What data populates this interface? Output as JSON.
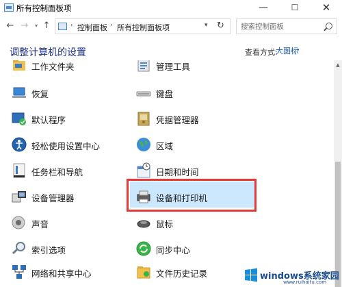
{
  "window": {
    "title": "所有控制面板项",
    "minimize_glyph": "—",
    "maximize_glyph": "☐",
    "close_glyph": "✕"
  },
  "navigation": {
    "back_glyph": "←",
    "forward_glyph": "→",
    "recent_glyph": "▾",
    "up_glyph": "↑",
    "breadcrumbs": [
      "控制面板",
      "所有控制面板项"
    ],
    "breadcrumb_separator": "›",
    "address_dropdown_glyph": "▾",
    "refresh_glyph": "↻"
  },
  "search": {
    "placeholder": "搜索控制面板",
    "value": ""
  },
  "header": {
    "title": "调整计算机的设置",
    "view_by_label": "查看方式:",
    "view_by_value": "大图标",
    "view_by_arrow": "▾"
  },
  "items": [
    {
      "label": "工作文件夹",
      "icon": "work-folders-icon"
    },
    {
      "label": "管理工具",
      "icon": "admin-tools-icon"
    },
    {
      "label": "恢复",
      "icon": "recovery-icon"
    },
    {
      "label": "键盘",
      "icon": "keyboard-icon"
    },
    {
      "label": "默认程序",
      "icon": "default-programs-icon"
    },
    {
      "label": "凭据管理器",
      "icon": "credential-manager-icon"
    },
    {
      "label": "轻松使用设置中心",
      "icon": "ease-of-access-icon"
    },
    {
      "label": "区域",
      "icon": "region-globe-icon"
    },
    {
      "label": "任务栏和导航",
      "icon": "taskbar-icon"
    },
    {
      "label": "日期和时间",
      "icon": "date-time-icon"
    },
    {
      "label": "设备管理器",
      "icon": "device-manager-icon"
    },
    {
      "label": "设备和打印机",
      "icon": "printer-icon",
      "selected": true
    },
    {
      "label": "声音",
      "icon": "sound-icon"
    },
    {
      "label": "鼠标",
      "icon": "mouse-icon"
    },
    {
      "label": "索引选项",
      "icon": "indexing-icon"
    },
    {
      "label": "同步中心",
      "icon": "sync-center-icon"
    },
    {
      "label": "网络和共享中心",
      "icon": "network-icon"
    },
    {
      "label": "文件历史记录",
      "icon": "file-history-icon"
    }
  ],
  "colors": {
    "title_blue": "#1e3287",
    "link_blue": "#1a5fb4",
    "selection": "#cce8ff",
    "annotation_red": "#e53935"
  },
  "watermark": {
    "text": "windows系统家园",
    "url": "www.ruihaitu.com"
  }
}
